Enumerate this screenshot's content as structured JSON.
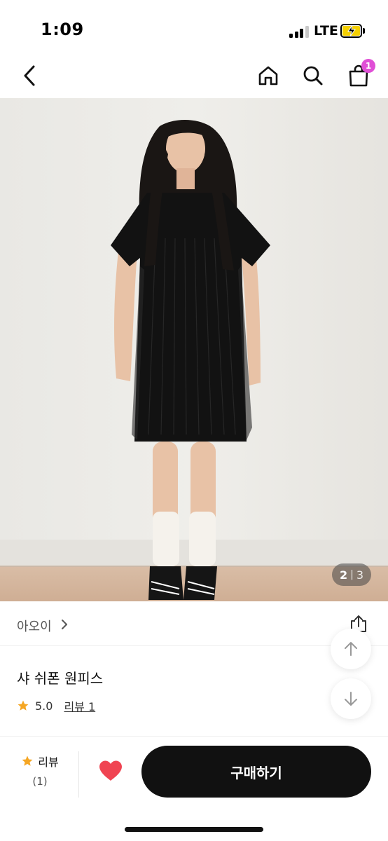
{
  "status_bar": {
    "time": "1:09",
    "network": "LTE"
  },
  "header": {
    "icons": [
      "back-chevron-icon",
      "home-icon",
      "search-icon",
      "shopping-bag-icon"
    ],
    "cart_badge": "1",
    "badge_color": "#e04fd6"
  },
  "gallery": {
    "current": "2",
    "separator": "|",
    "total": "3"
  },
  "product": {
    "brand": "아오이",
    "title": "샤 쉬폰 원피스",
    "rating": "5.0",
    "review_link": "리뷰 1"
  },
  "bottom_bar": {
    "review_label": "리뷰",
    "review_count": "(1)",
    "buy_label": "구매하기",
    "heart_color": "#f04452",
    "star_color": "#f5a623",
    "button_color": "#111111"
  }
}
